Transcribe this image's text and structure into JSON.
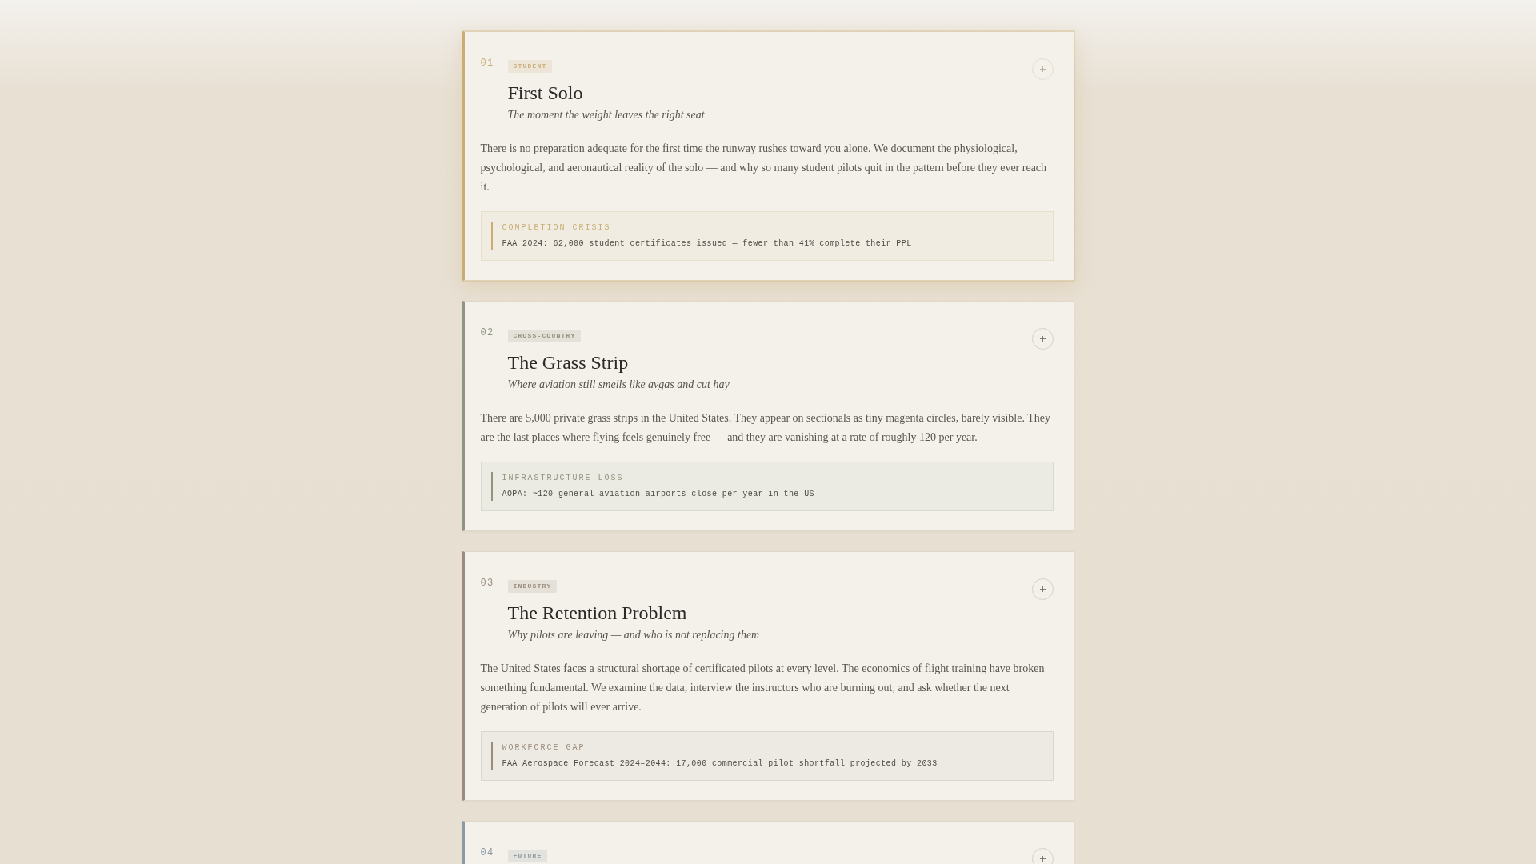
{
  "cards": [
    {
      "number": "01",
      "tag": "STUDENT",
      "color": "#c9ad74",
      "highlighted": true,
      "expanded": false,
      "title": "First Solo",
      "subtitle": "The moment the weight leaves the right seat",
      "description": "There is no preparation adequate for the first time the runway rushes toward you alone. We document the physiological, psychological, and aeronautical reality of the solo — and why so many student pilots quit in the pattern before they ever reach it.",
      "stat": {
        "label": "COMPLETION CRISIS",
        "value": "FAA 2024: 62,000 student certificates issued — fewer than 41% complete their PPL"
      }
    },
    {
      "number": "02",
      "tag": "CROSS-COUNTRY",
      "color": "#8f957f",
      "highlighted": false,
      "expanded": false,
      "title": "The Grass Strip",
      "subtitle": "Where aviation still smells like avgas and cut hay",
      "description": "There are 5,000 private grass strips in the United States. They appear on sectionals as tiny magenta circles, barely visible. They are the last places where flying feels genuinely free — and they are vanishing at a rate of roughly 120 per year.",
      "stat": {
        "label": "INFRASTRUCTURE LOSS",
        "value": "AOPA: ~120 general aviation airports close per year in the US"
      }
    },
    {
      "number": "03",
      "tag": "INDUSTRY",
      "color": "#9b8c7d",
      "highlighted": false,
      "expanded": false,
      "title": "The Retention Problem",
      "subtitle": "Why pilots are leaving — and who is not replacing them",
      "description": "The United States faces a structural shortage of certificated pilots at every level. The economics of flight training have broken something fundamental. We examine the data, interview the instructors who are burning out, and ask whether the next generation of pilots will ever arrive.",
      "stat": {
        "label": "WORKFORCE GAP",
        "value": "FAA Aerospace Forecast 2024–2044: 17,000 commercial pilot shortfall projected by 2033"
      }
    },
    {
      "number": "04",
      "tag": "FUTURE",
      "color": "#8b9aa3",
      "highlighted": false,
      "expanded": false
    }
  ]
}
